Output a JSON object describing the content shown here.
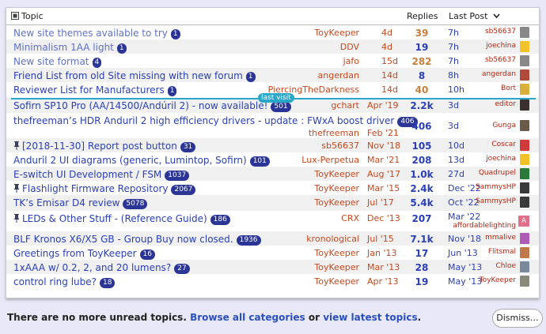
{
  "header": {
    "topic_label": "Topic",
    "replies_label": "Replies",
    "lastpost_label": "Last Post"
  },
  "last_visit_label": "last visit",
  "rows": [
    {
      "title": "New site themes available to try",
      "badge": "1",
      "poster": "ToyKeeper",
      "date": "4d",
      "replies": "39",
      "last": "7h",
      "lastuser": "sb56637",
      "pinned": false,
      "read": true,
      "hot": true,
      "avatar_color": "#888"
    },
    {
      "title": "Minimalism 1AA light",
      "badge": "1",
      "poster": "DDV",
      "date": "4d",
      "replies": "19",
      "last": "7h",
      "lastuser": "joechina",
      "pinned": false,
      "read": true,
      "hot": false,
      "avatar_color": "#f2c22a"
    },
    {
      "title": "New site format",
      "badge": "4",
      "poster": "jafo",
      "date": "15d",
      "replies": "282",
      "last": "7h",
      "lastuser": "sb56637",
      "pinned": false,
      "read": true,
      "hot": true,
      "avatar_color": "#888"
    },
    {
      "title": "Friend List from old Site missing with new forum",
      "badge": "1",
      "poster": "angerdan",
      "date": "14d",
      "replies": "8",
      "last": "8h",
      "lastuser": "angerdan",
      "pinned": false,
      "read": false,
      "hot": false,
      "avatar_color": "#b04b3b"
    },
    {
      "title": "Reviewer List for Manufacturers",
      "badge": "1",
      "poster": "PiercingTheDarkness",
      "date": "14d",
      "replies": "40",
      "last": "10h",
      "lastuser": "Bort",
      "pinned": false,
      "read": false,
      "hot": true,
      "avatar_color": "#d8b03a"
    },
    {
      "title": "Sofirn SP10 Pro (AA/14500/Andúril 2) - now available!",
      "badge": "501",
      "poster": "gchart",
      "date": "Apr '19",
      "replies": "2.2k",
      "last": "3d",
      "lastuser": "editor",
      "pinned": false,
      "read": false,
      "hot": false,
      "avatar_color": "#3a3030"
    },
    {
      "title": "thefreeman’s HDR Anduril 2 high efficiency drivers - update : FWxA boost driver",
      "badge": "406",
      "poster": "thefreeman",
      "date": "Feb '21",
      "replies": "406",
      "last": "3d",
      "lastuser": "Gunga",
      "pinned": false,
      "read": false,
      "hot": false,
      "avatar_color": "#6a5a4a"
    },
    {
      "title": "[2018-11-30] Report post button",
      "badge": "31",
      "poster": "sb56637",
      "date": "Nov '18",
      "replies": "105",
      "last": "10d",
      "lastuser": "Coscar",
      "pinned": true,
      "read": false,
      "hot": false,
      "avatar_color": "#d03a3a"
    },
    {
      "title": "Anduril 2 UI diagrams (generic, Lumintop, Sofirn)",
      "badge": "101",
      "poster": "Lux-Perpetua",
      "date": "Mar '21",
      "replies": "208",
      "last": "13d",
      "lastuser": "joechina",
      "pinned": false,
      "read": false,
      "hot": false,
      "avatar_color": "#f2c22a"
    },
    {
      "title": "E-switch UI Development / FSM",
      "badge": "1037",
      "poster": "ToyKeeper",
      "date": "Aug '17",
      "replies": "1.0k",
      "last": "27d",
      "lastuser": "Quadrupel",
      "pinned": false,
      "read": false,
      "hot": false,
      "avatar_color": "#2a7a3a"
    },
    {
      "title": "Flashlight Firmware Repository",
      "badge": "2067",
      "poster": "ToyKeeper",
      "date": "Mar '15",
      "replies": "2.4k",
      "last": "Dec '22",
      "lastuser": "SammysHP",
      "pinned": true,
      "read": false,
      "hot": false,
      "avatar_color": "#3a3a3a"
    },
    {
      "title": "TK’s Emisar D4 review",
      "badge": "5078",
      "poster": "ToyKeeper",
      "date": "Jul '17",
      "replies": "5.4k",
      "last": "Oct '22",
      "lastuser": "SammysHP",
      "pinned": false,
      "read": false,
      "hot": false,
      "avatar_color": "#3a3a3a"
    },
    {
      "title": "LEDs & Other Stuff - (Reference Guide)",
      "badge": "186",
      "poster": "CRX",
      "date": "Dec '13",
      "replies": "207",
      "last": "Mar '22",
      "lastuser": "affordablelighting",
      "pinned": true,
      "read": false,
      "hot": false,
      "avatar_color": "#e06d8a",
      "avatar_letter": "A"
    },
    {
      "title": "BLF Kronos X6/X5 GB - Group Buy now closed.",
      "badge": "1936",
      "poster": "kronological",
      "date": "Jul '15",
      "replies": "7.1k",
      "last": "Nov '18",
      "lastuser": "mmalive",
      "pinned": false,
      "read": false,
      "hot": false,
      "avatar_color": "#b05ab8"
    },
    {
      "title": "Greetings from ToyKeeper",
      "badge": "16",
      "poster": "ToyKeeper",
      "date": "Jan '13",
      "replies": "17",
      "last": "Jun '13",
      "lastuser": "Flitsmal",
      "pinned": false,
      "read": false,
      "hot": false,
      "avatar_color": "#c07a4a"
    },
    {
      "title": "1xAAA w/ 0.2, 2, and 20 lumens?",
      "badge": "27",
      "poster": "ToyKeeper",
      "date": "Mar '13",
      "replies": "28",
      "last": "May '13",
      "lastuser": "Chloe",
      "pinned": false,
      "read": false,
      "hot": false,
      "avatar_color": "#7a8a9a"
    },
    {
      "title": "control ring lube?",
      "badge": "18",
      "poster": "ToyKeeper",
      "date": "Apr '13",
      "replies": "19",
      "last": "May '13",
      "lastuser": "ToyKeeper",
      "pinned": false,
      "read": false,
      "hot": false,
      "avatar_color": "#8a8a7a"
    }
  ],
  "footer": {
    "text_prefix": "There are no more unread topics.",
    "browse_link": "Browse all categories",
    "or_text": "or",
    "latest_link": "view latest topics",
    "period": ".",
    "dismiss_label": "Dismiss…"
  },
  "colors": {
    "link": "#2a3fb5",
    "poster": "#c9471c",
    "hot_replies": "#c87f3a",
    "badge": "#2b3595",
    "last_visit": "#29a7c8"
  }
}
